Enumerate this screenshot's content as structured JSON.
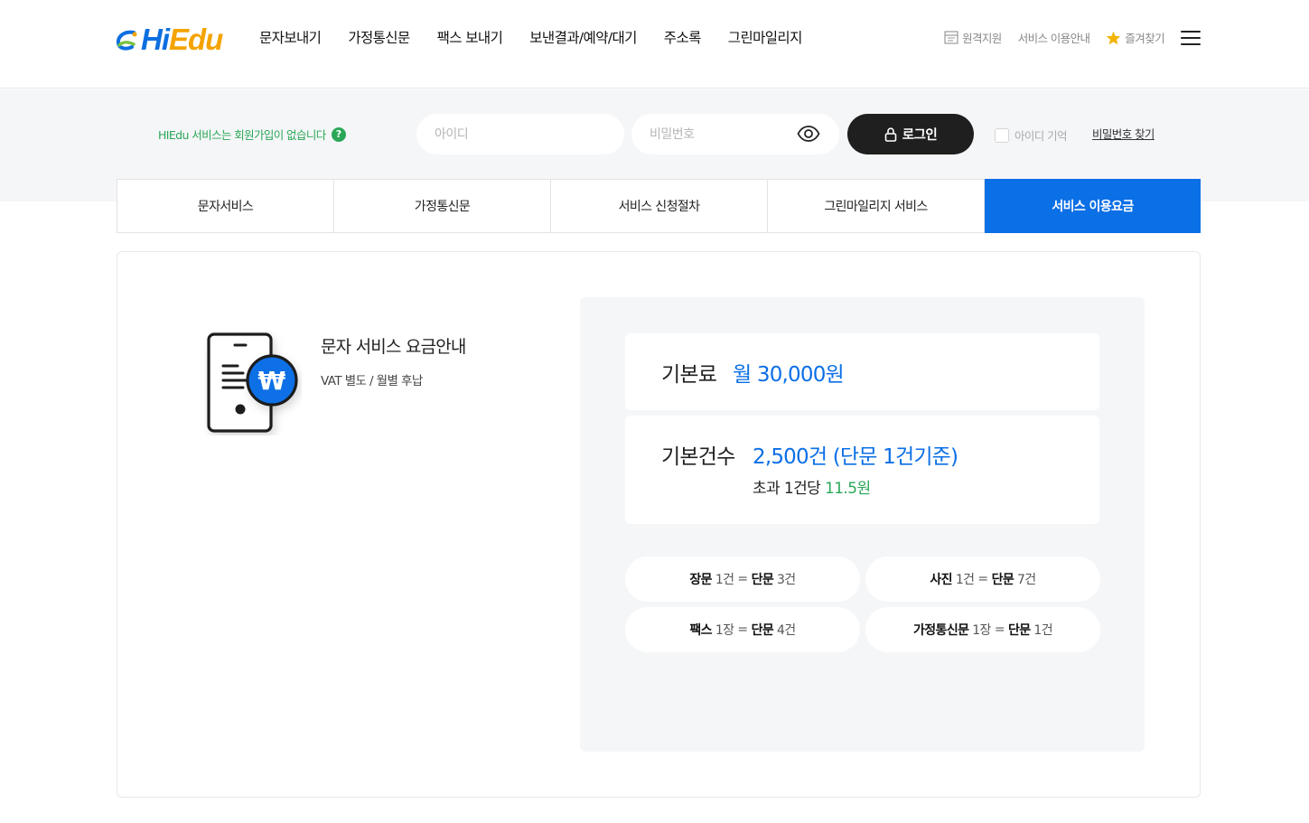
{
  "colors": {
    "brand_blue": "#0b6fe6",
    "brand_orange": "#f4a300",
    "accent_green": "#2aa757",
    "dark_button": "#1f1f1f",
    "band_bg": "#f5f6f8"
  },
  "header": {
    "logo": {
      "hi": "Hi",
      "edu": "Edu"
    },
    "nav": [
      "문자보내기",
      "가정통신문",
      "팩스 보내기",
      "보낸결과/예약/대기",
      "주소록",
      "그린마일리지"
    ],
    "util": {
      "remote": "원격지원",
      "guide": "서비스 이용안내",
      "favorite": "즐겨찾기"
    },
    "icons": {
      "remote": "document-icon",
      "favorite": "star-icon",
      "menu": "hamburger-menu-icon"
    }
  },
  "login": {
    "notice": "HIEdu 서비스는 회원가입이 없습니다",
    "help_glyph": "?",
    "id_placeholder": "아이디",
    "pw_placeholder": "비밀번호",
    "login_label": "로그인",
    "remember_label": "아이디 기억",
    "find_pw": "비밀번호 찾기"
  },
  "tabs": [
    {
      "label": "문자서비스",
      "active": false
    },
    {
      "label": "가정통신문",
      "active": false
    },
    {
      "label": "서비스 신청절차",
      "active": false
    },
    {
      "label": "그린마일리지 서비스",
      "active": false
    },
    {
      "label": "서비스 이용요금",
      "active": true
    }
  ],
  "pricing": {
    "title": "문자 서비스 요금안내",
    "subtitle": "VAT 별도 / 월별 후납",
    "won_glyph": "₩",
    "base_fee": {
      "label": "기본료",
      "value": "월 30,000원"
    },
    "base_count": {
      "label": "기본건수",
      "value": "2,500건 (단문 1건기준)",
      "extra_prefix": "초과 1건당",
      "extra_value": "11.5원"
    },
    "conversions": [
      {
        "item": "장문",
        "unit": "1건",
        "eq": "=",
        "target": "단문",
        "target_unit": "3건"
      },
      {
        "item": "사진",
        "unit": "1건",
        "eq": "=",
        "target": "단문",
        "target_unit": "7건"
      },
      {
        "item": "팩스",
        "unit": "1장",
        "eq": "=",
        "target": "단문",
        "target_unit": "4건"
      },
      {
        "item": "가정통신문",
        "unit": "1장",
        "eq": "=",
        "target": "단문",
        "target_unit": "1건"
      }
    ]
  }
}
